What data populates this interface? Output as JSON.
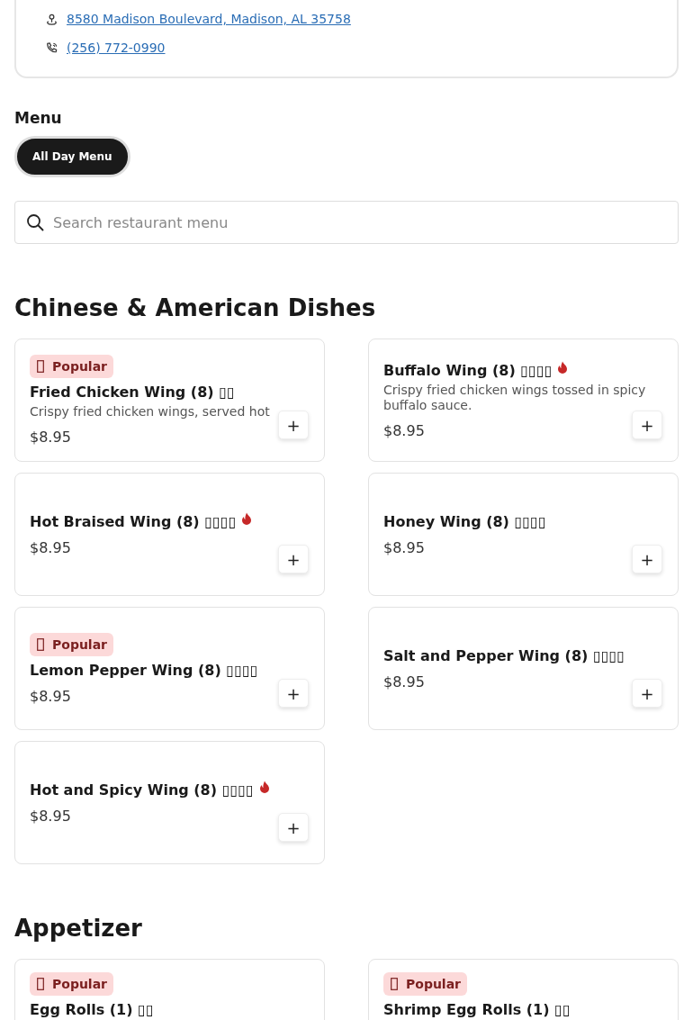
{
  "location": {
    "address": "8580 Madison Boulevard, Madison, AL 35758",
    "phone": "(256) 772-0990"
  },
  "menu": {
    "title": "Menu",
    "tabs": [
      {
        "label": "All Day Menu",
        "selected": true
      }
    ]
  },
  "search": {
    "placeholder": "Search restaurant menu"
  },
  "sections": [
    {
      "title": "Chinese & American Dishes",
      "items": [
        {
          "name": "Fried Chicken Wing (8) ▯▯",
          "popular": true,
          "badge": "Popular",
          "description": "Crispy fried chicken wings, served hot",
          "price": "$8.95",
          "spicy": false,
          "add": "+"
        },
        {
          "name": "Buffalo Wing (8) ▯▯▯▯",
          "popular": false,
          "description": "Crispy fried chicken wings tossed in spicy buffalo sauce.",
          "price": "$8.95",
          "spicy": true,
          "add": "+"
        },
        {
          "name": "Hot Braised Wing (8) ▯▯▯▯",
          "popular": false,
          "price": "$8.95",
          "spicy": true,
          "add": "+"
        },
        {
          "name": "Honey Wing (8) ▯▯▯▯",
          "popular": false,
          "price": "$8.95",
          "spicy": false,
          "add": "+"
        },
        {
          "name": "Lemon Pepper Wing (8) ▯▯▯▯",
          "popular": true,
          "badge": "Popular",
          "price": "$8.95",
          "spicy": false,
          "add": "+"
        },
        {
          "name": "Salt and Pepper Wing (8) ▯▯▯▯",
          "popular": false,
          "price": "$8.95",
          "spicy": false,
          "add": "+"
        },
        {
          "name": "Hot and Spicy Wing (8) ▯▯▯▯",
          "popular": false,
          "price": "$8.95",
          "spicy": true,
          "add": "+"
        }
      ]
    },
    {
      "title": "Appetizer",
      "items": [
        {
          "name": "Egg Rolls (1) ▯▯",
          "popular": true,
          "badge": "Popular",
          "partial": true
        },
        {
          "name": "Shrimp Egg Rolls (1) ▯▯",
          "popular": true,
          "badge": "Popular",
          "partial": true
        }
      ]
    }
  ]
}
